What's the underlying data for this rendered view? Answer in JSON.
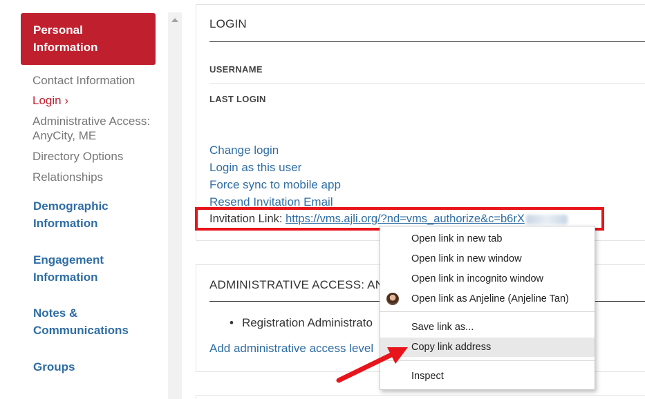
{
  "sidebar": {
    "active_label": "Personal Information",
    "sub_items": [
      {
        "label": "Contact Information"
      },
      {
        "label": "Login ›"
      },
      {
        "label": "Administrative Access: AnyCity, ME"
      },
      {
        "label": "Directory Options"
      },
      {
        "label": "Relationships"
      }
    ],
    "sections": [
      {
        "label": "Demographic Information"
      },
      {
        "label": "Engagement Information"
      },
      {
        "label": "Notes & Communications"
      },
      {
        "label": "Groups"
      }
    ]
  },
  "login_panel": {
    "title": "LOGIN",
    "username_label": "USERNAME",
    "last_login_label": "LAST LOGIN",
    "links": [
      {
        "label": "Change login"
      },
      {
        "label": "Login as this user"
      },
      {
        "label": "Force sync to mobile app"
      },
      {
        "label": "Resend Invitation Email"
      }
    ],
    "invitation_label": "Invitation Link:",
    "invitation_url": "https://vms.ajli.org/?nd=vms_authorize&c=b6rX"
  },
  "admin_panel": {
    "title": "ADMINISTRATIVE ACCESS: AN",
    "bullet": "Registration Administrato",
    "add_link": "Add administrative access level"
  },
  "context_menu": {
    "items": [
      {
        "label": "Open link in new tab"
      },
      {
        "label": "Open link in new window"
      },
      {
        "label": "Open link in incognito window"
      },
      {
        "label": "Open link as Anjeline (Anjeline Tan)"
      },
      {
        "label": "Save link as..."
      },
      {
        "label": "Copy link address"
      },
      {
        "label": "Inspect"
      }
    ]
  },
  "colors": {
    "accent": "#c0202e",
    "link": "#2e6da4",
    "annotation": "#e8141b"
  }
}
